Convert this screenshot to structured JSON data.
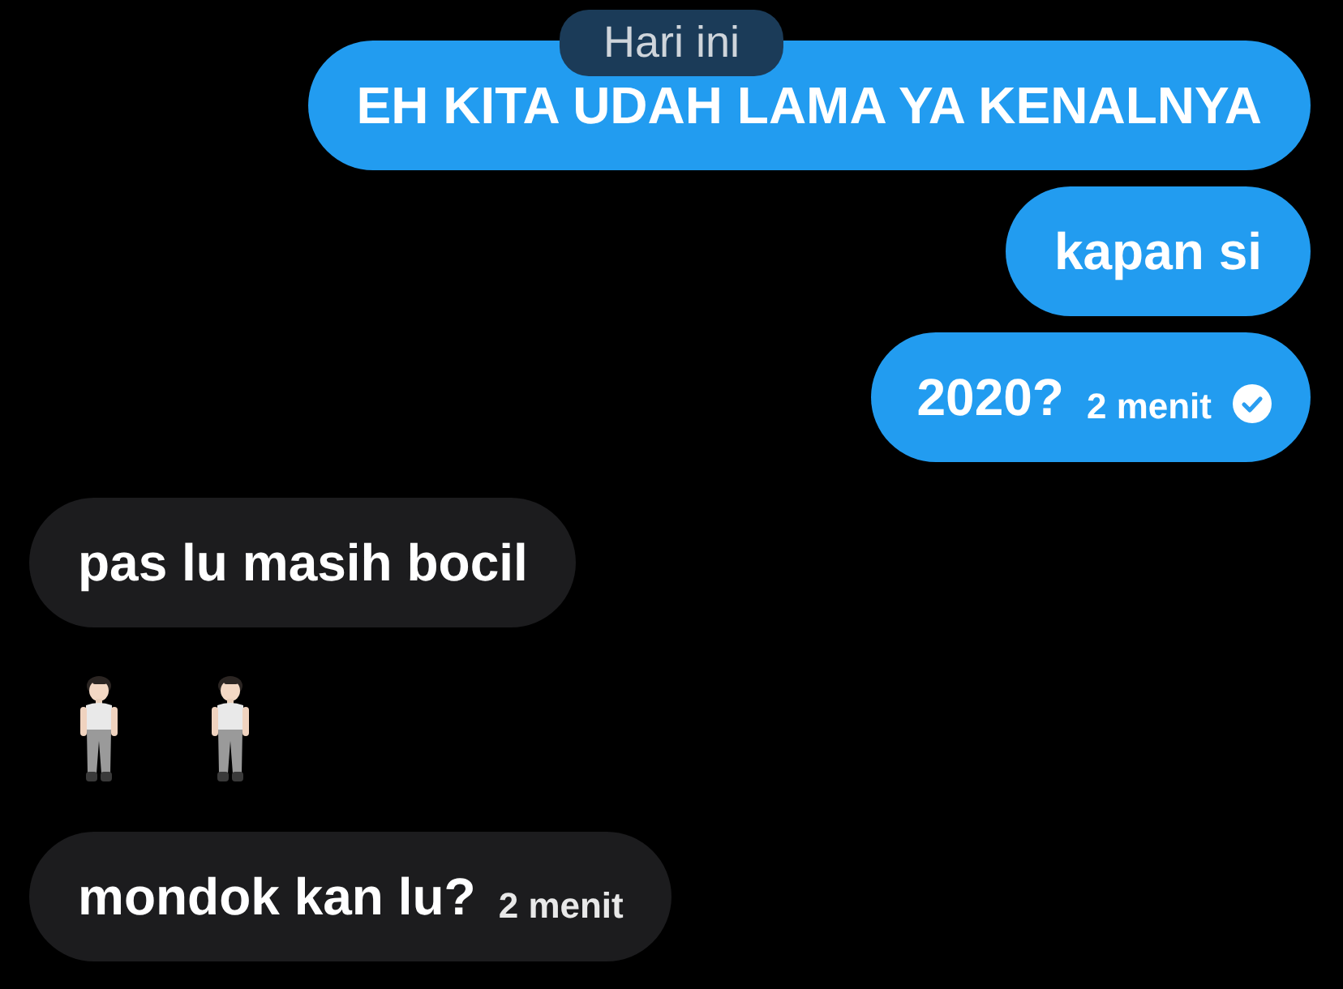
{
  "date_pill": {
    "label": "Hari ini"
  },
  "messages": [
    {
      "kind": "text",
      "outgoing": true,
      "text": "EH KITA UDAH LAMA YA KENALNYA"
    },
    {
      "kind": "text",
      "outgoing": true,
      "text": "kapan si"
    },
    {
      "kind": "text",
      "outgoing": true,
      "text": "2020?",
      "time": "2 menit",
      "read": true
    },
    {
      "kind": "text",
      "outgoing": false,
      "text": "pas lu masih bocil"
    },
    {
      "kind": "emoji",
      "outgoing": false,
      "emojis": [
        {
          "kind": "person"
        },
        {
          "kind": "person"
        }
      ]
    },
    {
      "kind": "text",
      "outgoing": false,
      "text": "mondok kan lu?",
      "time": "2 menit"
    }
  ]
}
